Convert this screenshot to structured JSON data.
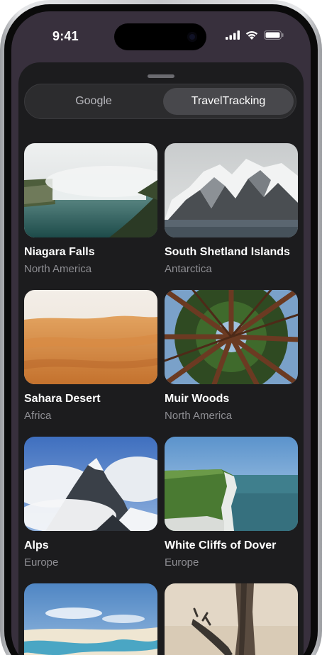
{
  "status_bar": {
    "time": "9:41",
    "icons": [
      "signal-icon",
      "wifi-icon",
      "battery-icon"
    ]
  },
  "segmented_control": {
    "segments": [
      {
        "label": "Google",
        "selected": false
      },
      {
        "label": "TravelTracking",
        "selected": true
      }
    ]
  },
  "places": [
    {
      "title": "Niagara Falls",
      "subtitle": "North America",
      "image": "waterfall-photo"
    },
    {
      "title": "South Shetland Islands",
      "subtitle": "Antarctica",
      "image": "snowy-mountains-photo"
    },
    {
      "title": "Sahara Desert",
      "subtitle": "Africa",
      "image": "sand-dunes-photo"
    },
    {
      "title": "Muir Woods",
      "subtitle": "North America",
      "image": "redwood-canopy-photo"
    },
    {
      "title": "Alps",
      "subtitle": "Europe",
      "image": "alpine-peaks-photo"
    },
    {
      "title": "White Cliffs of Dover",
      "subtitle": "Europe",
      "image": "coastal-cliffs-photo"
    },
    {
      "title": "",
      "subtitle": "",
      "image": "lagoon-dunes-photo"
    },
    {
      "title": "",
      "subtitle": "",
      "image": "desert-tree-photo"
    }
  ],
  "colors": {
    "sheet_background": "#1c1c1e",
    "segment_selected": "#48484c",
    "secondary_text": "#8e8e93"
  }
}
